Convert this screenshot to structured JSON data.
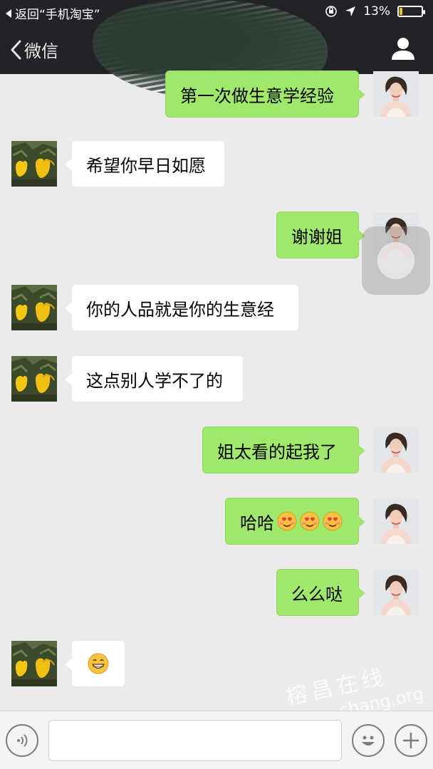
{
  "status_bar": {
    "back_label": "返回“手机淘宝”",
    "battery_text": "13%",
    "battery_level": 0.13
  },
  "nav": {
    "back_label": "微信"
  },
  "messages": [
    {
      "side": "out",
      "text": "第一次做生意学经验"
    },
    {
      "side": "in",
      "text": "希望你早日如愿"
    },
    {
      "side": "out",
      "text": "谢谢姐"
    },
    {
      "side": "in",
      "text": "你的人品就是你的生意经"
    },
    {
      "side": "in",
      "text": "这点别人学不了的"
    },
    {
      "side": "out",
      "text": "姐太看的起我了"
    },
    {
      "side": "out",
      "text": "哈哈",
      "emoji_count": 3,
      "emoji": "blushing-heart-eyes-emoji"
    },
    {
      "side": "out",
      "text": "么么哒"
    },
    {
      "side": "in",
      "text": "",
      "emoji_count": 1,
      "emoji": "grinning-emoji"
    }
  ],
  "watermark": {
    "text": "榕昌在线",
    "sub": "chang.org"
  },
  "input_bar": {
    "input_value": "",
    "voice_icon": "voice-icon",
    "emoji_icon": "emoji-icon",
    "plus_icon": "plus-icon"
  },
  "colors": {
    "outgoing_bubble": "#9fe86b",
    "incoming_bubble": "#ffffff",
    "header": "#232327",
    "chat_bg": "#ebebeb"
  }
}
